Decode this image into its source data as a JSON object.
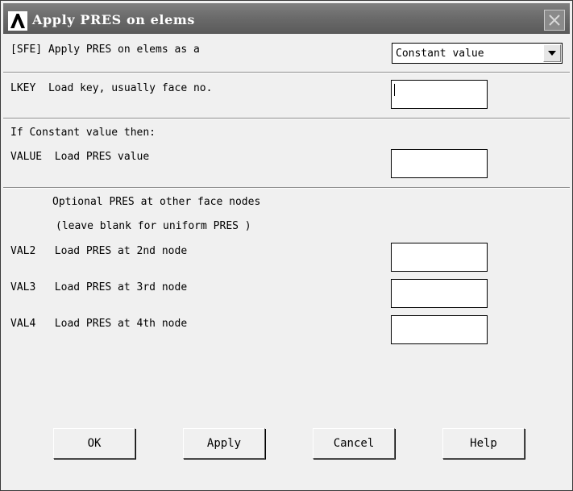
{
  "window": {
    "title": "Apply PRES on elems"
  },
  "icons": {
    "logo": "ansys-logo-icon",
    "close": "close-icon",
    "dropdown": "chevron-down-icon"
  },
  "apply_as": {
    "label": "[SFE] Apply PRES on elems as a",
    "selected": "Constant value"
  },
  "lkey": {
    "label": "LKEY  Load key, usually face no.",
    "value": ""
  },
  "constant_section": {
    "header": "If Constant value then:",
    "value_label": "VALUE  Load PRES value",
    "value": ""
  },
  "optional_section": {
    "header_line1": "Optional PRES at other face nodes",
    "header_line2": "(leave blank for uniform PRES )",
    "val2_label": "VAL2   Load PRES at 2nd node",
    "val2": "",
    "val3_label": "VAL3   Load PRES at 3rd node",
    "val3": "",
    "val4_label": "VAL4   Load PRES at 4th node",
    "val4": ""
  },
  "buttons": {
    "ok": "OK",
    "apply": "Apply",
    "cancel": "Cancel",
    "help": "Help"
  }
}
